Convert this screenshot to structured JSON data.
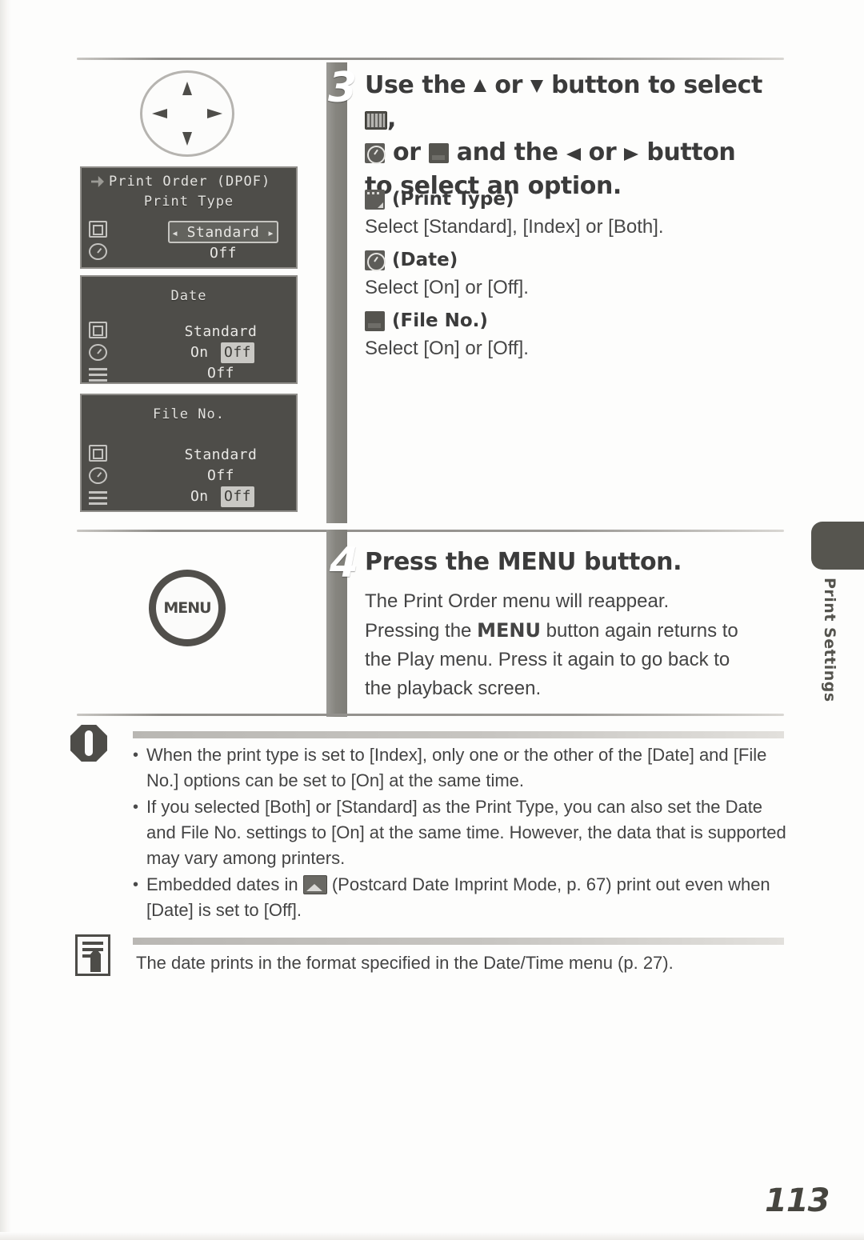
{
  "page": {
    "number": "113",
    "side_tab_label": "Print Settings"
  },
  "steps": [
    {
      "number": "3",
      "heading_line1_a": "Use the",
      "heading_line1_b": "or",
      "heading_line1_c": "button to select",
      "heading_line1_d": ",",
      "heading_line2_a": "or",
      "heading_line2_b": "and the",
      "heading_line2_c": "or",
      "heading_line2_d": "button",
      "heading_line3": "to select an option.",
      "options": [
        {
          "icon": "print-type-icon",
          "label": "(Print Type)",
          "instruction": "Select [Standard], [Index] or [Both]."
        },
        {
          "icon": "date-clock-icon",
          "label": "(Date)",
          "instruction": "Select [On] or [Off]."
        },
        {
          "icon": "file-no-icon",
          "label": "(File No.)",
          "instruction": "Select [On] or [Off]."
        }
      ]
    },
    {
      "number": "4",
      "heading": "Press the MENU button.",
      "body_line1": "The Print Order menu will reappear.",
      "body_line2_a": "Pressing the",
      "body_line2_bold": "MENU",
      "body_line2_b": "button again returns to",
      "body_line3": "the Play menu. Press it again to go back to",
      "body_line4": "the playback screen."
    }
  ],
  "illustrations": {
    "omni_selector": "omni-selector-icon",
    "menu_button_label": "MENU"
  },
  "lcd_screens": [
    {
      "name": "print-type-screen",
      "header": "Print Order (DPOF)",
      "title": "Print Type",
      "rows": [
        "Standard",
        "Off"
      ],
      "selected": "Standard",
      "left_caret": "◂",
      "right_caret": "▸"
    },
    {
      "name": "date-screen",
      "title": "Date",
      "rows": [
        "Standard",
        "Off"
      ],
      "toggle_left": "On",
      "toggle_right": "Off",
      "selected": "Off"
    },
    {
      "name": "file-no-screen",
      "title": "File No.",
      "rows": [
        "Standard",
        "Off"
      ],
      "toggle_left": "On",
      "toggle_right": "Off",
      "selected": "Off"
    }
  ],
  "warning": {
    "icon": "warning-icon",
    "bullets": [
      "When the print type is set to [Index], only one or the other of the [Date] and [File No.] options can be set to [On] at the same time.",
      "If you selected [Both] or [Standard] as the Print Type, you can also set the Date and File No. settings to [On] at the same time. However, the data that is supported may vary among printers.",
      "Embedded dates in"
    ],
    "bullet3_rest": "(Postcard Date Imprint Mode, p. 67) print out even when [Date] is set to [Off]."
  },
  "note": {
    "icon": "note-icon",
    "text": "The date prints in the format specified in the Date/Time menu (p. 27)."
  }
}
